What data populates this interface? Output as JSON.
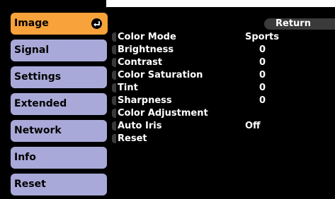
{
  "tabs": [
    {
      "label": "Image",
      "active": true
    },
    {
      "label": "Signal",
      "active": false
    },
    {
      "label": "Settings",
      "active": false
    },
    {
      "label": "Extended",
      "active": false
    },
    {
      "label": "Network",
      "active": false
    },
    {
      "label": "Info",
      "active": false
    },
    {
      "label": "Reset",
      "active": false
    }
  ],
  "return_label": "Return",
  "settings": [
    {
      "label": "Color Mode",
      "value": "Sports"
    },
    {
      "label": "Brightness",
      "value": "0"
    },
    {
      "label": "Contrast",
      "value": "0"
    },
    {
      "label": "Color Saturation",
      "value": "0"
    },
    {
      "label": "Tint",
      "value": "0"
    },
    {
      "label": "Sharpness",
      "value": "0"
    },
    {
      "label": "Color Adjustment",
      "value": ""
    },
    {
      "label": "Auto Iris",
      "value": "Off"
    },
    {
      "label": "Reset",
      "value": ""
    }
  ],
  "colors": {
    "active_tab": "#f7a23a",
    "inactive_tab": "#a9a9d9",
    "background": "#000000",
    "text": "#ffffff"
  },
  "icons": {
    "enter": "enter-icon"
  }
}
